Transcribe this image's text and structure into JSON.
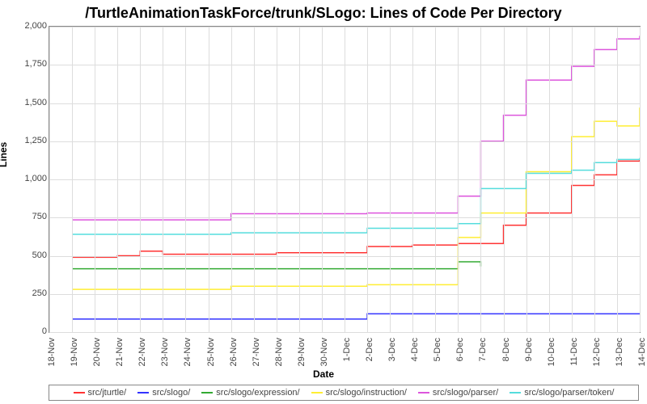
{
  "chart_data": {
    "type": "line",
    "title": "/TurtleAnimationTaskForce/trunk/SLogo: Lines of Code Per Directory",
    "xlabel": "Date",
    "ylabel": "Lines",
    "ylim": [
      0,
      2000
    ],
    "y_ticks": [
      0,
      250,
      500,
      750,
      1000,
      1250,
      1500,
      1750,
      2000
    ],
    "categories": [
      "18-Nov",
      "19-Nov",
      "20-Nov",
      "21-Nov",
      "22-Nov",
      "23-Nov",
      "24-Nov",
      "25-Nov",
      "26-Nov",
      "27-Nov",
      "28-Nov",
      "29-Nov",
      "30-Nov",
      "1-Dec",
      "2-Dec",
      "3-Dec",
      "4-Dec",
      "5-Dec",
      "6-Dec",
      "7-Dec",
      "8-Dec",
      "9-Dec",
      "10-Dec",
      "11-Dec",
      "12-Dec",
      "13-Dec",
      "14-Dec"
    ],
    "series": [
      {
        "name": "src/jturtle/",
        "color": "#ff3333",
        "values": [
          null,
          490,
          490,
          500,
          530,
          510,
          510,
          510,
          510,
          510,
          520,
          520,
          520,
          520,
          560,
          560,
          570,
          570,
          580,
          580,
          700,
          780,
          780,
          960,
          1030,
          1120,
          1130
        ]
      },
      {
        "name": "src/slogo/",
        "color": "#3333ff",
        "values": [
          null,
          85,
          85,
          85,
          85,
          85,
          85,
          85,
          85,
          85,
          85,
          85,
          85,
          85,
          120,
          120,
          120,
          120,
          120,
          120,
          120,
          120,
          120,
          120,
          120,
          120,
          120
        ]
      },
      {
        "name": "src/slogo/expression/",
        "color": "#33aa33",
        "values": [
          null,
          415,
          415,
          415,
          415,
          415,
          415,
          415,
          415,
          415,
          415,
          415,
          415,
          415,
          415,
          415,
          415,
          415,
          460,
          430,
          null,
          null,
          null,
          null,
          null,
          null,
          null
        ]
      },
      {
        "name": "src/slogo/instruction/",
        "color": "#ffee33",
        "values": [
          null,
          280,
          280,
          280,
          280,
          280,
          280,
          280,
          300,
          300,
          300,
          300,
          300,
          300,
          310,
          310,
          310,
          310,
          620,
          780,
          780,
          1050,
          1050,
          1280,
          1380,
          1350,
          1470
        ]
      },
      {
        "name": "src/slogo/parser/",
        "color": "#dd55dd",
        "values": [
          null,
          735,
          735,
          735,
          735,
          735,
          735,
          735,
          775,
          775,
          775,
          775,
          775,
          775,
          780,
          780,
          780,
          780,
          890,
          1250,
          1420,
          1650,
          1650,
          1740,
          1850,
          1920,
          1940
        ]
      },
      {
        "name": "src/slogo/parser/token/",
        "color": "#55dddd",
        "values": [
          null,
          640,
          640,
          640,
          640,
          640,
          640,
          640,
          650,
          650,
          650,
          650,
          650,
          650,
          680,
          680,
          680,
          680,
          710,
          940,
          940,
          1040,
          1040,
          1060,
          1110,
          1130,
          1140
        ]
      }
    ]
  }
}
